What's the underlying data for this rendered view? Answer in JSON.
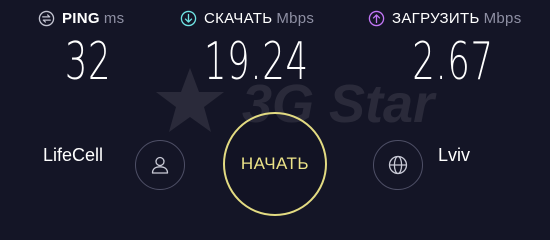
{
  "watermark": {
    "text": "3G Star"
  },
  "metrics": {
    "ping": {
      "label": "PING",
      "unit": "ms",
      "value": "32",
      "icon": "ping-icon",
      "color": "#c3c4d1"
    },
    "download": {
      "label": "СКАЧАТЬ",
      "unit": "Mbps",
      "value": "19.24",
      "icon": "download-icon",
      "color": "#6fe3e3"
    },
    "upload": {
      "label": "ЗАГРУЗИТЬ",
      "unit": "Mbps",
      "value": "2.67",
      "icon": "upload-icon",
      "color": "#c176f5"
    }
  },
  "isp": {
    "name": "LifeCell",
    "icon": "user-icon"
  },
  "server": {
    "name": "Lviv",
    "icon": "globe-icon"
  },
  "start_button": {
    "label": "НАЧАТЬ",
    "color": "#e3db82"
  },
  "colors": {
    "background": "#141526",
    "text": "#ffffff",
    "muted": "#8e8fa3"
  }
}
